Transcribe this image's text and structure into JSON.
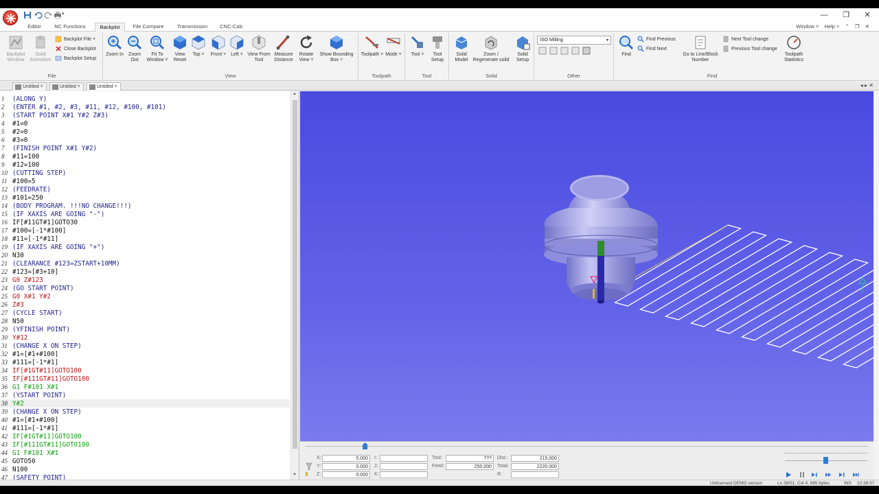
{
  "titlebar": {
    "quick_access": [
      "save-icon",
      "undo-icon",
      "redo-icon",
      "print-icon"
    ]
  },
  "tabs": [
    {
      "label": "Editor"
    },
    {
      "label": "NC Functions"
    },
    {
      "label": "Backplot",
      "active": true
    },
    {
      "label": "File Compare"
    },
    {
      "label": "Transmission"
    },
    {
      "label": "CNC-Calc"
    }
  ],
  "window_menu": {
    "window": "Window ˅",
    "help": "Help ˅"
  },
  "ribbon": {
    "file_group": {
      "label": "File",
      "backplot_window": "Backplot Window",
      "solid_animation": "Solid Animation",
      "backplot_file": "Backplot File ˅",
      "close_backplot": "Close Backplot",
      "backplot_setup": "Backplot Setup"
    },
    "view_group": {
      "label": "View",
      "buttons": [
        {
          "label": "Zoom In"
        },
        {
          "label": "Zoom Out"
        },
        {
          "label": "Fit To Window ˅"
        },
        {
          "label": "View Reset"
        },
        {
          "label": "Top ˅"
        },
        {
          "label": "Front ˅"
        },
        {
          "label": "Left ˅"
        },
        {
          "label": "View From Tool"
        },
        {
          "label": "Measure Distance"
        },
        {
          "label": "Rotate View ˅"
        },
        {
          "label": "Show Bounding Box ˅"
        }
      ]
    },
    "toolpath_group": {
      "label": "Toolpath",
      "toolpath": "Toolpath ˅",
      "mode": "Mode ˅"
    },
    "tool_group": {
      "label": "Tool",
      "tool": "Tool ˅",
      "tool_setup": "Tool Setup"
    },
    "solid_group": {
      "label": "Solid",
      "solid_model": "Solid Model",
      "zoom_regen": "Zoom / Regenerate solid",
      "solid_setup": "Solid Setup"
    },
    "other_group": {
      "label": "Other",
      "machine_type": "ISO Milling"
    },
    "find_group": {
      "label": "Find",
      "find": "Find",
      "find_previous": "Find Previous",
      "find_next": "Find Next",
      "goto_line": "Go to Line/Block Number",
      "next_tool_change": "Next Tool change",
      "previous_tool_change": "Previous Tool change",
      "toolpath_statistics": "Toolpath Statistics"
    }
  },
  "doc_tabs": [
    {
      "label": "Untitled ˅"
    },
    {
      "label": "Untitled ˅"
    },
    {
      "label": "Untitled ˅"
    }
  ],
  "editor": {
    "lines": [
      {
        "n": "1",
        "text": "(ALONG Y)",
        "style": "comment"
      },
      {
        "n": "2",
        "text": "(ENTER #1, #2, #3, #11, #12, #100, #101)",
        "style": "comment"
      },
      {
        "n": "3",
        "text": "(START POINT X#1 Y#2 Z#3)",
        "style": "comment"
      },
      {
        "n": "4",
        "text": "#1=0",
        "style": "normal"
      },
      {
        "n": "5",
        "text": "#2=0",
        "style": "normal"
      },
      {
        "n": "6",
        "text": "#3=0",
        "style": "normal"
      },
      {
        "n": "7",
        "text": "(FINISH POINT X#1 Y#2)",
        "style": "comment"
      },
      {
        "n": "8",
        "text": "#11=100",
        "style": "normal"
      },
      {
        "n": "9",
        "text": "#12=100",
        "style": "normal"
      },
      {
        "n": "10",
        "text": "(CUTTING STEP)",
        "style": "comment"
      },
      {
        "n": "11",
        "text": "#100=5",
        "style": "normal"
      },
      {
        "n": "12",
        "text": "(FEEDRATE)",
        "style": "comment"
      },
      {
        "n": "13",
        "text": "#101=250",
        "style": "normal"
      },
      {
        "n": "14",
        "text": "(BODY PROGRAM. !!!NO CHANGE!!!)",
        "style": "comment"
      },
      {
        "n": "15",
        "text": "(IF XAXIS ARE GOING \"-\")",
        "style": "comment"
      },
      {
        "n": "16",
        "text": "IF[#11GT#1]GOTO30",
        "style": "normal"
      },
      {
        "n": "17",
        "text": "#100=[-1*#100]",
        "style": "normal"
      },
      {
        "n": "18",
        "text": "#11=[-1*#11]",
        "style": "normal"
      },
      {
        "n": "19",
        "text": "(IF XAXIS ARE GOING \"+\")",
        "style": "comment"
      },
      {
        "n": "20",
        "text": "N30",
        "style": "normal"
      },
      {
        "n": "21",
        "text": "(CLEARANCE #123=ZSTART+10MM)",
        "style": "comment"
      },
      {
        "n": "22",
        "text": "#123=[#3+10]",
        "style": "normal"
      },
      {
        "n": "23",
        "text": "G0 Z#123",
        "style": "red"
      },
      {
        "n": "24",
        "text": "(GO START POINT)",
        "style": "comment"
      },
      {
        "n": "25",
        "text": "G0 X#1 Y#2",
        "style": "red"
      },
      {
        "n": "26",
        "text": "Z#3",
        "style": "red"
      },
      {
        "n": "27",
        "text": "(CYCLE START)",
        "style": "comment"
      },
      {
        "n": "28",
        "text": "N50",
        "style": "normal"
      },
      {
        "n": "29",
        "text": "(YFINISH POINT)",
        "style": "comment"
      },
      {
        "n": "30",
        "text": "Y#12",
        "style": "red"
      },
      {
        "n": "31",
        "text": "(CHANGE X ON STEP)",
        "style": "comment"
      },
      {
        "n": "32",
        "text": "#1=[#1+#100]",
        "style": "normal"
      },
      {
        "n": "33",
        "text": "#111=[-1*#1]",
        "style": "normal"
      },
      {
        "n": "34",
        "text": "IF[#1GT#11]GOTO100",
        "style": "red"
      },
      {
        "n": "35",
        "text": "IF[#111GT#11]GOTO100",
        "style": "red"
      },
      {
        "n": "36",
        "text": "G1 F#101 X#1",
        "style": "green"
      },
      {
        "n": "37",
        "text": "(YSTART POINT)",
        "style": "comment"
      },
      {
        "n": "38",
        "text": "Y#2",
        "style": "green",
        "current": true
      },
      {
        "n": "39",
        "text": "(CHANGE X ON STEP)",
        "style": "comment"
      },
      {
        "n": "40",
        "text": "#1=[#1+#100]",
        "style": "normal"
      },
      {
        "n": "41",
        "text": "#111=[-1*#1]",
        "style": "normal"
      },
      {
        "n": "42",
        "text": "IF[#1GT#11]GOTO100",
        "style": "green"
      },
      {
        "n": "43",
        "text": "IF[#111GT#11]GOTO100",
        "style": "green"
      },
      {
        "n": "44",
        "text": "G1 F#101 X#1",
        "style": "green"
      },
      {
        "n": "45",
        "text": "GOTO50",
        "style": "normal"
      },
      {
        "n": "46",
        "text": "N100",
        "style": "normal"
      },
      {
        "n": "47",
        "text": "(SAFETY POINT)",
        "style": "comment"
      }
    ]
  },
  "coords": {
    "x_label": "X:",
    "x": "5.000",
    "y_label": "Y:",
    "y": "0.000",
    "z_label": "Z:",
    "z": "0.000",
    "i_label": "I:",
    "j_label": "J:",
    "k_label": "K:",
    "tool_label": "Tool:",
    "tool": "???",
    "feed_label": "Feed:",
    "feed": "250.000",
    "dist_label": "Dist.:",
    "dist": "215.000",
    "total_label": "Total:",
    "total": "2220.000",
    "r_label": "R:"
  },
  "playback": {
    "progress": 0.105,
    "speed": 0.49
  },
  "statusbar": {
    "license": "Unlicensed DEMO version",
    "position": "Ln 38/51, Col 4, 685 bytes",
    "mode": "INS",
    "time": "12:38:57"
  },
  "colors": {
    "viewport_top": "#4a4ae0",
    "viewport_bottom": "#7b7bee",
    "toolpath": "#ffffff",
    "comment": "#1f1f8e",
    "rapid": "#c01616",
    "feed": "#11a011"
  }
}
